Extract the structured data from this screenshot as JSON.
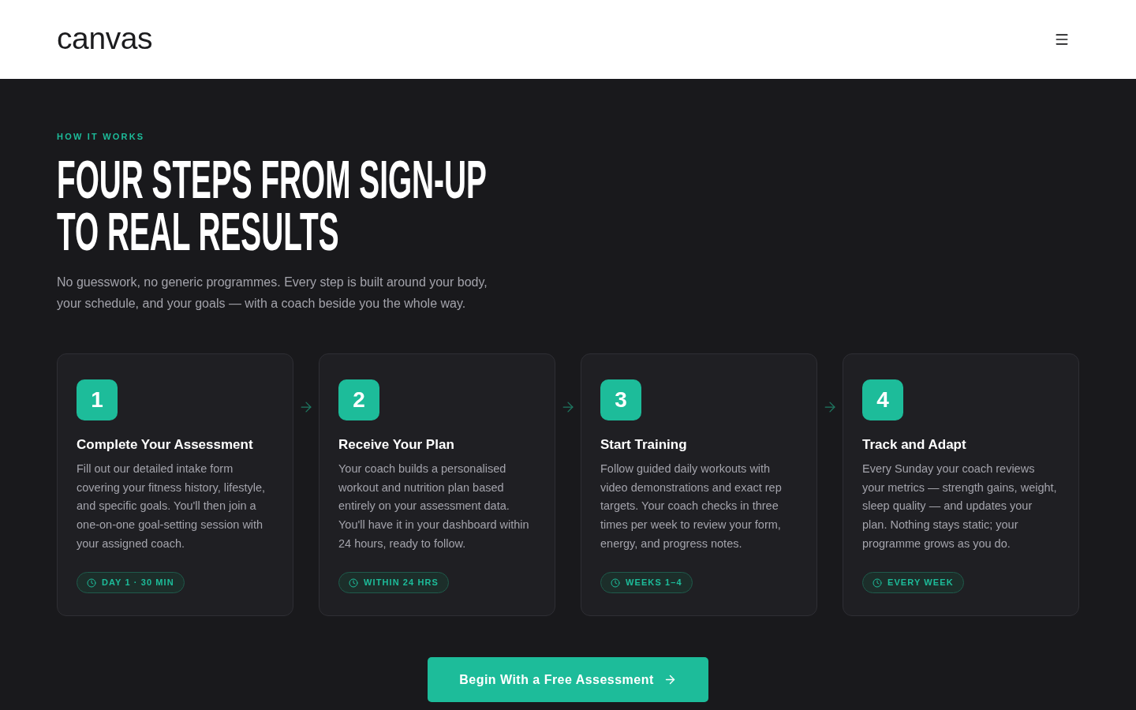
{
  "header": {
    "logo": "canvas"
  },
  "section": {
    "eyebrow": "HOW IT WORKS",
    "title_lines": [
      "FOUR STEPS FROM SIGN-UP",
      "TO REAL RESULTS"
    ],
    "intro": "No guesswork, no generic programmes. Every step is built around your body, your schedule, and your goals — with a coach beside you the whole way."
  },
  "steps": [
    {
      "number": "1",
      "title": "Complete Your Assessment",
      "description": "Fill out our detailed intake form covering your fitness history, lifestyle, and specific goals. You'll then join a one-on-one goal-setting session with your assigned coach.",
      "duration": "DAY 1 · 30 MIN"
    },
    {
      "number": "2",
      "title": "Receive Your Plan",
      "description": "Your coach builds a personalised workout and nutrition plan based entirely on your assessment data. You'll have it in your dashboard within 24 hours, ready to follow.",
      "duration": "WITHIN 24 HRS"
    },
    {
      "number": "3",
      "title": "Start Training",
      "description": "Follow guided daily workouts with video demonstrations and exact rep targets. Your coach checks in three times per week to review your form, energy, and progress notes.",
      "duration": "WEEKS 1–4"
    },
    {
      "number": "4",
      "title": "Track and Adapt",
      "description": "Every Sunday your coach reviews your metrics — strength gains, weight, sleep quality — and updates your plan. Nothing stays static; your programme grows as you do.",
      "duration": "EVERY WEEK"
    }
  ],
  "cta": {
    "label": "Begin With a Free Assessment"
  }
}
